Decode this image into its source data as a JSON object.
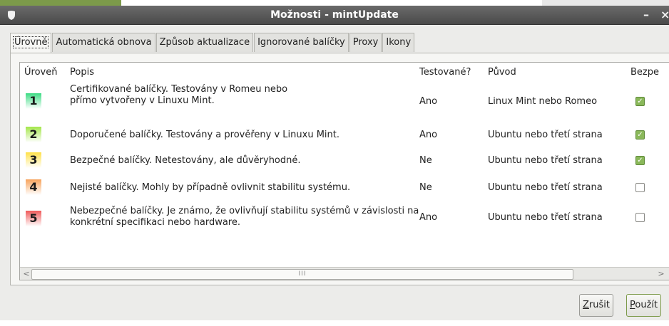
{
  "window": {
    "title": "Možnosti - mintUpdate",
    "minimize": "–",
    "close": "×"
  },
  "tabs": [
    {
      "label": "Úrovně",
      "active": true
    },
    {
      "label": "Automatická obnova"
    },
    {
      "label": "Způsob aktualizace"
    },
    {
      "label": "Ignorované balíčky"
    },
    {
      "label": "Proxy"
    },
    {
      "label": "Ikony"
    }
  ],
  "columns": {
    "level": "Úroveň",
    "description": "Popis",
    "tested": "Testované?",
    "origin": "Původ",
    "safe": "Bezpe"
  },
  "rows": [
    {
      "level": "1",
      "description": "Certifikované balíčky. Testovány v Romeu nebo přímo vytvořeny v Linuxu Mint.",
      "tested": "Ano",
      "origin": "Linux Mint nebo Romeo",
      "safe": true,
      "color": "#3ddc84"
    },
    {
      "level": "2",
      "description": "Doporučené balíčky. Testovány a prověřeny v Linuxu Mint.",
      "tested": "Ano",
      "origin": "Ubuntu nebo třetí strana",
      "safe": true,
      "color": "#a4e64a"
    },
    {
      "level": "3",
      "description": "Bezpečné balíčky. Netestovány, ale důvěryhodné.",
      "tested": "Ne",
      "origin": "Ubuntu nebo třetí strana",
      "safe": true,
      "color": "#ffe14a"
    },
    {
      "level": "4",
      "description": "Nejisté balíčky. Mohly by případně ovlivnit stabilitu systému.",
      "tested": "Ne",
      "origin": "Ubuntu nebo třetí strana",
      "safe": false,
      "color": "#f7a35c"
    },
    {
      "level": "5",
      "description": "Nebezpečné balíčky. Je známo, že ovlivňují stabilitu systémů v závislosti na konkrétní specifikaci nebo hardware.",
      "tested": "Ano",
      "origin": "Ubuntu nebo třetí strana",
      "safe": false,
      "color": "#f05a5a"
    }
  ],
  "scrollbar": {
    "left": "<",
    "right": ">",
    "grip": "III"
  },
  "buttons": {
    "cancel_mnemonic": "Z",
    "cancel_rest": "rušit",
    "apply_mnemonic": "P",
    "apply_rest": "oužít"
  },
  "icons": {
    "window": "shield-icon",
    "check": "check-icon"
  }
}
